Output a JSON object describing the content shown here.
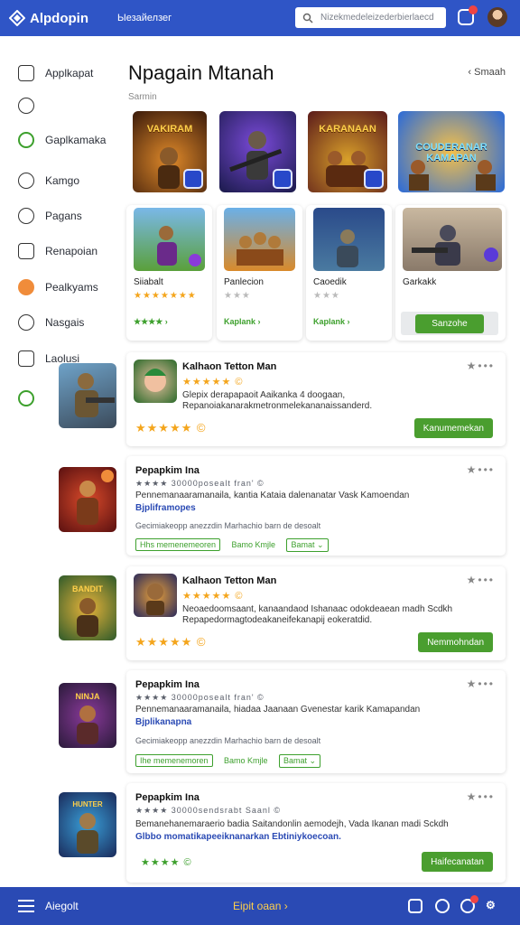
{
  "topbar": {
    "app_name": "Alpdopin",
    "subtitle": "Ыезайелзег",
    "search_placeholder": "Nizekmedeleizederbierlaecd",
    "notification_count": ""
  },
  "sidebar": {
    "items": [
      {
        "label": "Applkapat",
        "icon": "bookmark-icon"
      },
      {
        "label": "",
        "icon": "chat-icon"
      },
      {
        "label": "Gaplkamaka",
        "icon": "circle-check-icon"
      },
      {
        "label": "Kamgo",
        "icon": "speech-icon"
      },
      {
        "label": "Pagans",
        "icon": "info-icon"
      },
      {
        "label": "Renapoian",
        "icon": "card-icon"
      },
      {
        "label": "Pealkyams",
        "icon": "user-badge-icon"
      },
      {
        "label": "Nasgais",
        "icon": "settings-icon"
      },
      {
        "label": "Laolusi",
        "icon": "home-icon"
      },
      {
        "label": "",
        "icon": "home-outline-icon"
      }
    ]
  },
  "main": {
    "title": "Npagain Mtanah",
    "sort_label": "Smaah",
    "section_label": "Sarmin",
    "featured": [
      {
        "word": "VAKIRAM"
      },
      {
        "word": ""
      },
      {
        "word": "KARANAAN"
      },
      {
        "word": "COUDERANAR KAMAPAN"
      }
    ],
    "cards": [
      {
        "name": "Siiabalt",
        "stars": "★★★★★★★",
        "footer": "★★★★ ›"
      },
      {
        "name": "Panlecion",
        "stars": "★★★",
        "footer": "Kaplank ›"
      },
      {
        "name": "Caoedik",
        "stars": "★★★",
        "footer": "Kaplank ›"
      },
      {
        "name": "Garkakk",
        "stars": "",
        "footer": "Sanzohe"
      }
    ],
    "rows": [
      {
        "name": "Kalhaon Tetton Man",
        "meta": "★★★★★ ©",
        "desc": "Glepix derapapaoit Aaikanka 4 doogaan, Repanoiakanarakmetronmelekananaissanderd.",
        "stars": "★★★★★ ©",
        "action": "Kanumemekan"
      },
      {
        "name": "Pepapkim Ina",
        "meta": "★★★★ 30000posealt fran' ©",
        "desc": "Pennemanaaramanaila, kantia Kataia dalenanatar Vask Kamoendan",
        "link": "Bjpliframopes",
        "note": "Gecimiakeopp anezzdin Marhachio barn de desoalt",
        "tag1": "Hhs memenemeoren",
        "tag2": "Bamo Kmjle",
        "select": "Bamat"
      },
      {
        "name": "Kalhaon Tetton Man",
        "meta": "★★★★★ ©",
        "desc": "Neoaedoomsaant, kanaandaod Ishanaac odokdeaean madh Scdkh Repapedormagtodeakaneifekanapij eokeratdid.",
        "stars": "★★★★★ ©",
        "action": "Nemmohndan"
      },
      {
        "name": "Pepapkim Ina",
        "meta": "★★★★ 30000posealt fran' ©",
        "desc": "Pennemanaaramanaila, hiadaa Jaanaan Gvenestar karik Kamapandan",
        "link": "Bjplikanapna",
        "note": "Gecimiakeopp anezzdin Marhachio barn de desoalt",
        "tag1": "Ihe memenemoren",
        "tag2": "Bamo Kmjle",
        "select": "Bamat"
      },
      {
        "name": "Pepapkim Ina",
        "meta": "★★★★ 30000sendsrabt Saanl ©",
        "desc": "Bemanehanemaraerio badia Saitandonlin aemodejh, Vada Ikanan madi Sckdh",
        "link": "Glbbo momatikapeeiknanarkan Ebtiniykoecoan.",
        "stars": "★★★★ ©",
        "action": "Haifecanatan"
      }
    ]
  },
  "bottombar": {
    "left_label": "Aiegolt",
    "center_label": "Eipit oaan ›"
  },
  "colors": {
    "brand": "#2f55c6",
    "accent_green": "#4a9e2f",
    "star": "#f4a51c"
  }
}
